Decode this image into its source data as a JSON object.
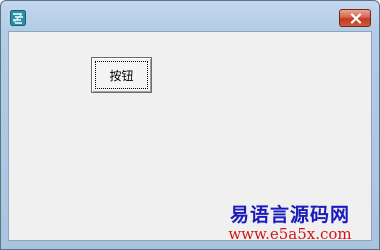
{
  "window": {
    "icon": "app-icon",
    "close_icon": "close-icon"
  },
  "button": {
    "label": "按钮"
  },
  "watermark": {
    "title": "易语言源码网",
    "url": "www.e5a5x.com"
  },
  "colors": {
    "client_bg": "#f0f0f0",
    "close_red": "#c23a1f",
    "watermark_title": "#1b1bbd",
    "watermark_url": "#d41414"
  }
}
